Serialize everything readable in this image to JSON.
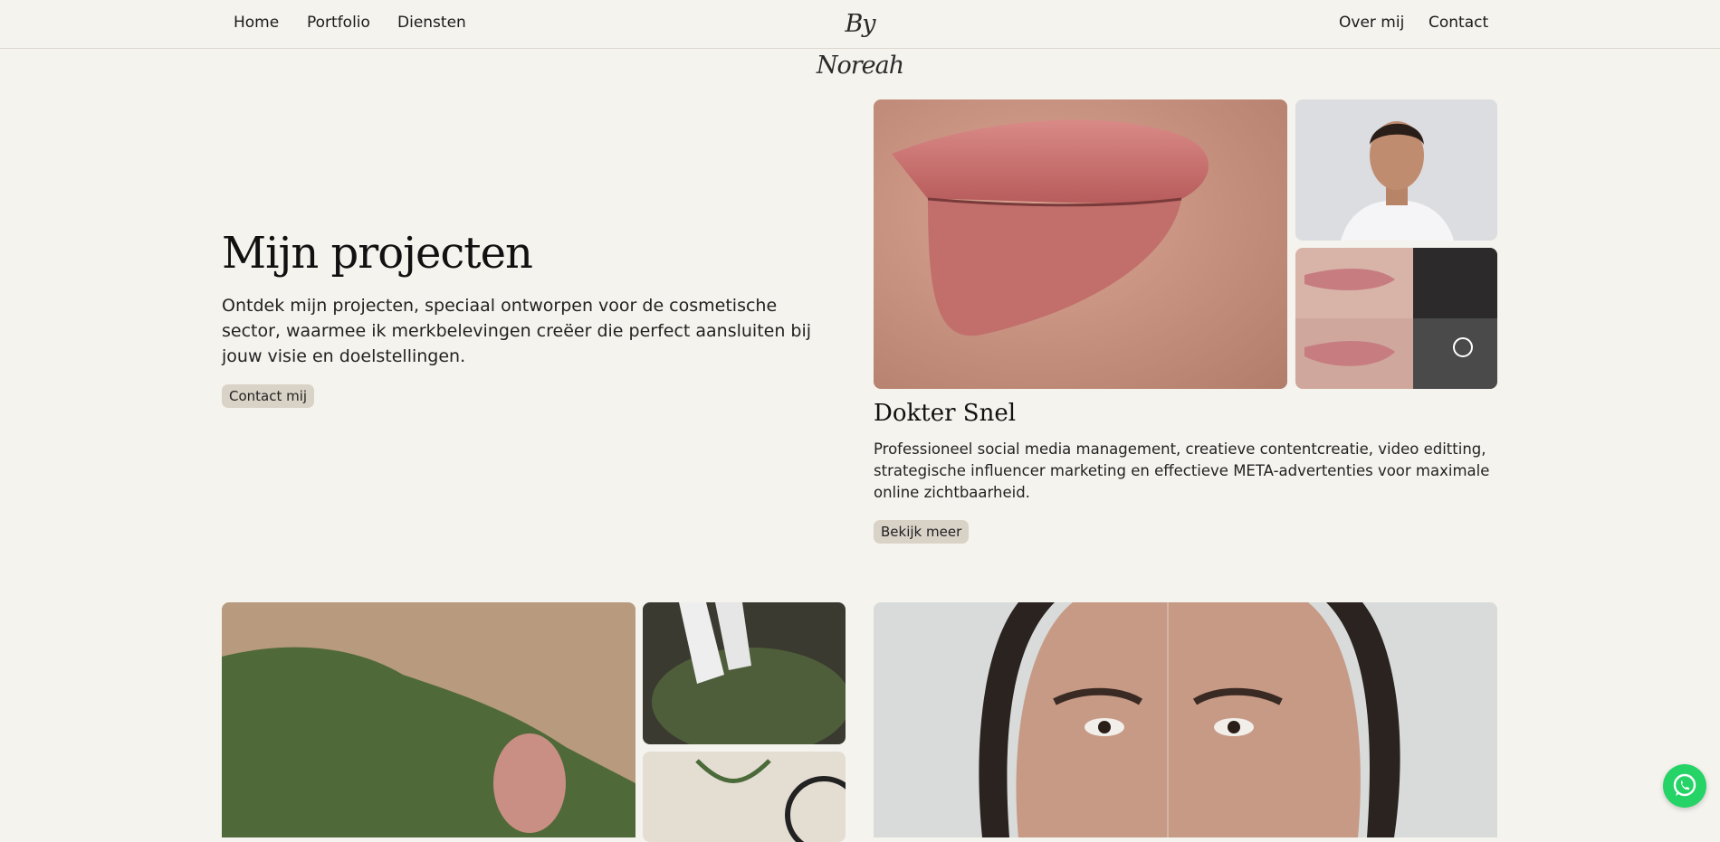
{
  "nav": {
    "left": [
      "Home",
      "Portfolio",
      "Diensten"
    ],
    "logo": "By Noreah",
    "right": [
      "Over mij",
      "Contact"
    ]
  },
  "hero": {
    "title": "Mijn projecten",
    "text": "Ontdek mijn projecten, speciaal ontworpen voor de cosmetische sector, waarmee ik merkbelevingen creëer die perfect aansluiten bij jouw visie en doelstellingen.",
    "button": "Contact mij"
  },
  "project1": {
    "title": "Dokter Snel",
    "text": "Professioneel social media management, creatieve contentcreatie, video editting, strategische influencer marketing en effectieve META-advertenties voor maximale online zichtbaarheid.",
    "button": "Bekijk meer"
  },
  "colors": {
    "background": "#f5f3ee",
    "pill": "#d9d2c7",
    "whatsapp": "#25d366"
  },
  "icons": {
    "whatsapp": "whatsapp-icon"
  }
}
